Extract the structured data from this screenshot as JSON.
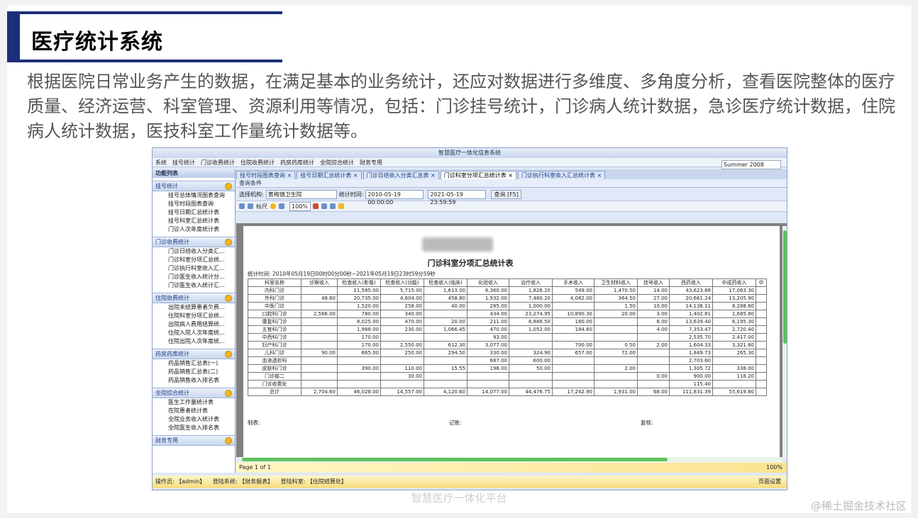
{
  "slide": {
    "title": "医疗统计系统",
    "description": "根据医院日常业务产生的数据，在满足基本的业务统计，还应对数据进行多维度、多角度分析，查看医院整体的医疗质量、经济运营、科室管理、资源利用等情况，包括：门诊挂号统计，门诊病人统计数据，急诊医疗统计数据，住院病人统计数据，医技科室工作量统计数据等。",
    "caption": "智慧医疗一体化平台",
    "corner_mark": "@稀土掘金技术社区"
  },
  "app": {
    "window_title": "智慧医疗一体化信息系统",
    "menu": [
      "系统",
      "挂号统计",
      "门诊收费统计",
      "住院收费统计",
      "药房药库统计",
      "全院综合统计",
      "财务专用"
    ],
    "theme": "Summer 2008",
    "sidebar_title": "功能列表",
    "groups": [
      {
        "label": "挂号统计",
        "items": [
          "挂号总体情况图表查询",
          "挂号时段图表查询",
          "挂号日期汇总统计表",
          "挂号科室汇总统计表",
          "门诊人次年度统计表"
        ]
      },
      {
        "label": "门诊收费统计",
        "items": [
          "门诊日结收入分类汇...",
          "门诊科室分项汇总统...",
          "门诊执行科室收入汇...",
          "门诊医生收入统计分...",
          "门诊医生收入统计汇..."
        ]
      },
      {
        "label": "住院收费统计",
        "items": [
          "出院未结算患者欠费...",
          "住院科室分项汇总统...",
          "出院病人费用结算统...",
          "住院入院人次年度统...",
          "住院出院人次年度统..."
        ]
      },
      {
        "label": "药房药库统计",
        "items": [
          "药品销售汇总表(一)",
          "药品销售汇总表(二)",
          "药品销售收入排名表"
        ]
      },
      {
        "label": "全院综合统计",
        "items": [
          "医生工作量统计表",
          "在院患者统计表",
          "全院业务收入统计表",
          "全院医生收入排名表"
        ]
      },
      {
        "label": "财务专用",
        "items": []
      }
    ],
    "tabs": [
      "挂号时段图表查询",
      "挂号日期汇总统计表",
      "门诊日结收入分类汇总表",
      "门诊科室分项汇总统计表",
      "门诊执行科室收入汇总统计表"
    ],
    "active_tab": 3,
    "query": {
      "header": "查询条件",
      "org_label": "选择机构:",
      "org_value": "黄梅镇卫生院",
      "time_label": "统计时间:",
      "start": "2010-05-19 00:00:00",
      "end": "2021-05-19 23:59:59",
      "button": "查询 [F5]"
    },
    "toolbar": {
      "ruler": "标尺",
      "zoom": "100%"
    },
    "report": {
      "title": "门诊科室分项汇总统计表",
      "stat_time": "统计时间:   2010年05月19日00时00分00秒~2021年05月19日23时59分59秒",
      "headers": [
        "科室名称",
        "诊察收入",
        "检查收入(影像)",
        "检查收入(功能)",
        "检查收入(临床)",
        "化验收入",
        "治疗收入",
        "手术收入",
        "卫生材料收入",
        "挂号收入",
        "西药收入",
        "中成药收入",
        "中"
      ],
      "rows": [
        [
          "内科门诊",
          "",
          "11,585.00",
          "5,715.00",
          "1,613.00",
          "6,360.00",
          "1,826.20",
          "549.00",
          "1,470.50",
          "14.00",
          "43,623.88",
          "17,063.30",
          ""
        ],
        [
          "外科门诊",
          "48.60",
          "20,735.00",
          "4,604.00",
          "458.80",
          "1,932.00",
          "7,460.20",
          "4,082.00",
          "364.50",
          "27.00",
          "20,661.24",
          "13,205.90",
          ""
        ],
        [
          "中医门诊",
          "",
          "1,520.00",
          "258.00",
          "40.00",
          "285.00",
          "1,000.00",
          "",
          "1.50",
          "10.00",
          "14,136.11",
          "8,288.60",
          ""
        ],
        [
          "口腔科门诊",
          "2,566.00",
          "780.00",
          "340.00",
          "",
          "434.00",
          "23,274.95",
          "10,890.30",
          "20.00",
          "3.00",
          "1,402.81",
          "1,685.80",
          ""
        ],
        [
          "康复科门诊",
          "",
          "8,025.00",
          "470.00",
          "20.00",
          "211.00",
          "8,888.50",
          "180.00",
          "",
          "8.00",
          "13,639.40",
          "6,195.30",
          ""
        ],
        [
          "五官科门诊",
          "",
          "1,988.00",
          "230.00",
          "1,066.45",
          "470.00",
          "1,052.00",
          "184.60",
          "",
          "4.00",
          "7,353.47",
          "2,720.40",
          ""
        ],
        [
          "中西科门诊",
          "",
          "170.00",
          "",
          "",
          "93.00",
          "",
          "",
          "",
          "",
          "2,535.70",
          "2,417.00",
          ""
        ],
        [
          "妇产科门诊",
          "",
          "170.00",
          "2,550.00",
          "612.30",
          "3,077.00",
          "",
          "700.00",
          "0.50",
          "2.00",
          "1,604.33",
          "3,321.80",
          ""
        ],
        [
          "儿科门诊",
          "90.00",
          "665.00",
          "250.00",
          "294.50",
          "330.00",
          "324.90",
          "657.00",
          "72.00",
          "",
          "1,849.73",
          "265.30",
          ""
        ],
        [
          "血液透析科",
          "",
          "",
          "",
          "",
          "687.00",
          "600.00",
          "",
          "",
          "",
          "2,703.60",
          "",
          ""
        ],
        [
          "皮肤科门诊",
          "",
          "390.00",
          "110.00",
          "15.55",
          "198.00",
          "50.00",
          "",
          "2.00",
          "",
          "1,305.72",
          "338.00",
          ""
        ],
        [
          "门诊部二",
          "",
          "",
          "30.00",
          "",
          "",
          "",
          "",
          "",
          "0.00",
          "900.00",
          "118.20",
          ""
        ],
        [
          "门诊收费处",
          "",
          "",
          "",
          "",
          "",
          "",
          "",
          "",
          "",
          "115.40",
          "",
          ""
        ],
        [
          "总计",
          "2,704.60",
          "46,028.00",
          "14,557.00",
          "4,120.60",
          "14,077.00",
          "44,476.75",
          "17,242.90",
          "1,931.00",
          "68.00",
          "111,831.39",
          "55,619.80",
          ""
        ]
      ],
      "sign_maker": "制表:",
      "sign_record": "记账:",
      "sign_check": "复核:"
    },
    "page_status": "Page 1 of 1",
    "page_zoom": "100%",
    "status": {
      "operator": "操作员: 【admin】",
      "system": "登陆系统: 【财务报表】",
      "dept": "登陆科室: 【住院结算处】",
      "right": "页面设置"
    }
  }
}
